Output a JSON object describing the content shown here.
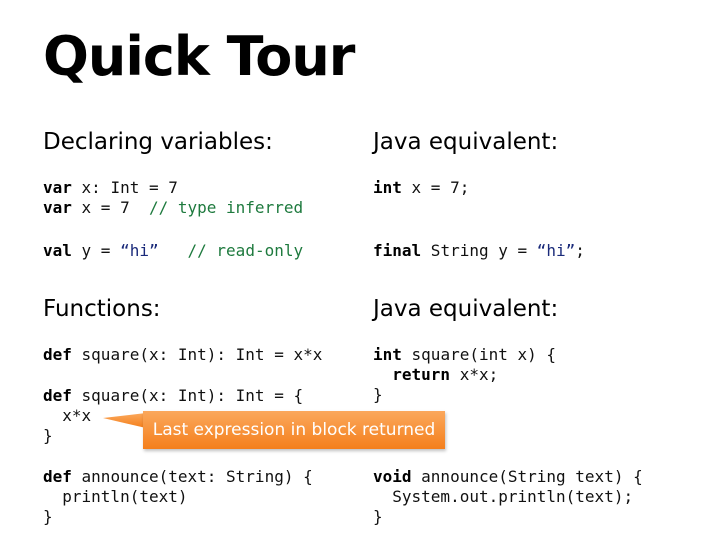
{
  "title": "Quick Tour",
  "sections": {
    "variables": {
      "heading": "Declaring variables:",
      "java_heading": "Java equivalent:",
      "scala": {
        "line1": {
          "kw": "var",
          "rest": " x: Int = 7"
        },
        "line2": {
          "kw": "var",
          "rest": " x = 7  ",
          "comment": "// type inferred"
        },
        "line3": {
          "kw": "val",
          "rest": " y = ",
          "str": "“hi”",
          "comment": "// read-only"
        }
      },
      "java": {
        "line1": {
          "kw": "int",
          "rest": " x = 7;"
        },
        "line2": {
          "kw": "final",
          "rest": " String y = ",
          "str": "“hi”",
          "end": ";"
        }
      }
    },
    "functions": {
      "heading": "Functions:",
      "java_heading": "Java equivalent:",
      "scala": {
        "def1": {
          "kw": "def",
          "rest": " square(x: Int): Int = x*x"
        },
        "def2": {
          "kw": "def",
          "rest": " square(x: Int): Int = {",
          "body": "  x*x",
          "close": "}"
        },
        "def3": {
          "kw": "def",
          "rest": " announce(text: String) {",
          "body": "  println(text)",
          "close": "}"
        }
      },
      "java": {
        "fn1": {
          "kw": "int",
          "rest": " square(int x) {",
          "body_kw": "return",
          "body_rest": " x*x;",
          "close": "}"
        },
        "fn2": {
          "kw": "void",
          "rest": " announce(String text) {",
          "body": "  System.out.println(text);",
          "close": "}"
        }
      }
    }
  },
  "callout": {
    "text": "Last expression in block returned",
    "color": "#f58a2a"
  }
}
